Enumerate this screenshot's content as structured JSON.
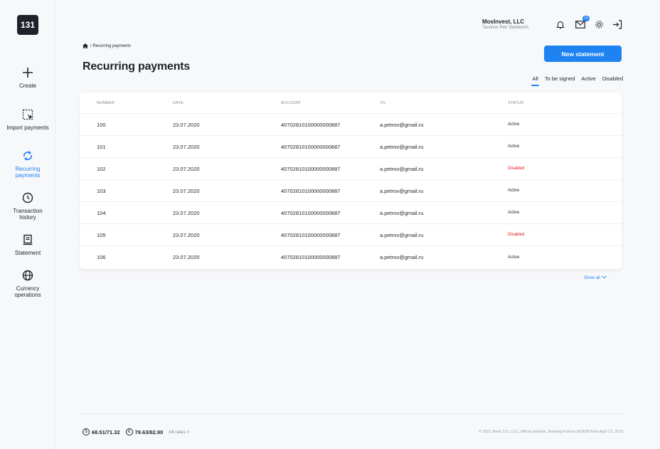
{
  "logo": "131",
  "sidebar": {
    "items": [
      {
        "label": "Create",
        "icon": "plus-icon"
      },
      {
        "label": "Import payments",
        "icon": "import-icon"
      },
      {
        "label": "Recurring payments",
        "icon": "recurring-icon",
        "active": true
      },
      {
        "label": "Transaction history",
        "icon": "clock-icon"
      },
      {
        "label": "Statement",
        "icon": "statement-icon"
      },
      {
        "label": "Currency operations",
        "icon": "globe-icon"
      }
    ]
  },
  "header": {
    "company": "MosInvest, LLC",
    "user": "Taurinov Petr Vasilievich",
    "mail_badge": "10",
    "icons": [
      "bell-icon",
      "mail-icon",
      "gear-icon",
      "logout-icon"
    ]
  },
  "breadcrumb": "/ Recurring payments",
  "page_title": "Recurring payments",
  "new_statement_label": "New statement",
  "filters": [
    "All",
    "To be signed",
    "Active",
    "Disabled"
  ],
  "table": {
    "columns": [
      "Number",
      "Date",
      "Account",
      "To",
      "Status"
    ],
    "rows": [
      {
        "number": "100",
        "date": "23.07.2020",
        "account": "40702810100000000887",
        "to": "a.petrov@gmail.ru",
        "status": "Active"
      },
      {
        "number": "101",
        "date": "23.07.2020",
        "account": "40702810100000000887",
        "to": "a.petrov@gmail.ru",
        "status": "Active"
      },
      {
        "number": "102",
        "date": "23.07.2020",
        "account": "40702810100000000887",
        "to": "a.petrov@gmail.ru",
        "status": "Disabled"
      },
      {
        "number": "103",
        "date": "23.07.2020",
        "account": "40702810100000000887",
        "to": "a.petrov@gmail.ru",
        "status": "Active"
      },
      {
        "number": "104",
        "date": "23.07.2020",
        "account": "40702810100000000887",
        "to": "a.petrov@gmail.ru",
        "status": "Active"
      },
      {
        "number": "105",
        "date": "23.07.2020",
        "account": "40702810100000000887",
        "to": "a.petrov@gmail.ru",
        "status": "Disabled"
      },
      {
        "number": "106",
        "date": "23.07.2020",
        "account": "40702810100000000887",
        "to": "a.petrov@gmail.ru",
        "status": "Active"
      }
    ]
  },
  "show_all": "Show all",
  "footer": {
    "usd_symbol": "$",
    "usd_rate": "68.51/71.32",
    "eur_symbol": "€",
    "eur_rate": "79.63/82.90",
    "all_rates": "All rates >",
    "copyright": "© 2021 Bank 131, LLC, official website. Banking license №3538 from April 12, 2019."
  },
  "colors": {
    "accent": "#1e82f0",
    "disabled": "#e02020",
    "text": "#1f2329"
  }
}
